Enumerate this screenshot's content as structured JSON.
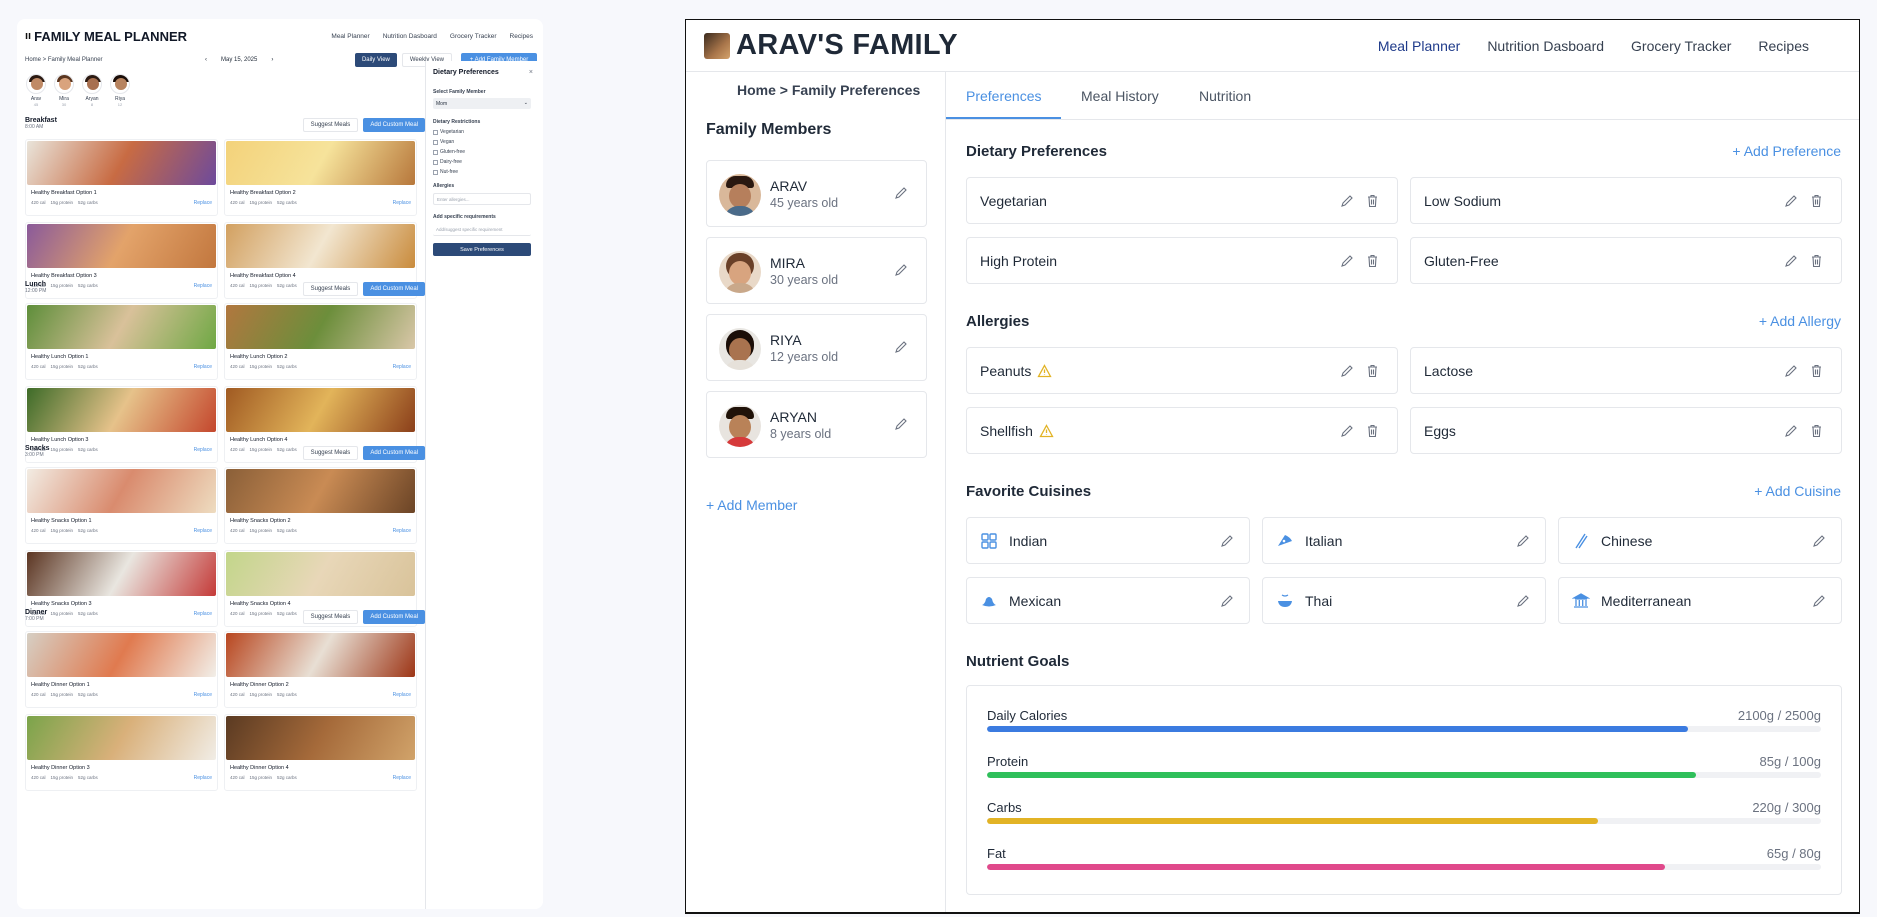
{
  "left": {
    "title": "FAMILY MEAL PLANNER",
    "title_icon": "fork-knife-icon",
    "nav": [
      "Meal Planner",
      "Nutrition Dasboard",
      "Grocery Tracker",
      "Recipes"
    ],
    "breadcrumb": "Home > Family Meal Planner",
    "date": "May 15, 2025",
    "prev": "‹",
    "next": "›",
    "daily_view": "Daily View",
    "weekly_view": "Weekly View",
    "add_family_member": "+ Add Family Member",
    "members": [
      {
        "name": "Arav",
        "age": "45"
      },
      {
        "name": "Mira",
        "age": "30"
      },
      {
        "name": "Aryan",
        "age": "8"
      },
      {
        "name": "Riya",
        "age": "12"
      }
    ],
    "suggest_meals": "Suggest Meals",
    "add_custom_meal": "Add Custom Meal",
    "replace": "Replace",
    "meals": [
      {
        "name": "Breakfast",
        "time": "8:00 AM",
        "options": [
          {
            "title": "Healthy Breakfast Option 1",
            "cal": "420 cal",
            "protein": "15g protein",
            "carbs": "52g carbs"
          },
          {
            "title": "Healthy Breakfast Option 2",
            "cal": "420 cal",
            "protein": "15g protein",
            "carbs": "52g carbs"
          },
          {
            "title": "Healthy Breakfast Option 3",
            "cal": "420 cal",
            "protein": "15g protein",
            "carbs": "52g carbs"
          },
          {
            "title": "Healthy Breakfast Option 4",
            "cal": "420 cal",
            "protein": "15g protein",
            "carbs": "52g carbs"
          }
        ]
      },
      {
        "name": "Lunch",
        "time": "12:00 PM",
        "options": [
          {
            "title": "Healthy Lunch Option 1",
            "cal": "420 cal",
            "protein": "15g protein",
            "carbs": "52g carbs"
          },
          {
            "title": "Healthy Lunch Option 2",
            "cal": "420 cal",
            "protein": "15g protein",
            "carbs": "52g carbs"
          },
          {
            "title": "Healthy Lunch Option 3",
            "cal": "420 cal",
            "protein": "15g protein",
            "carbs": "52g carbs"
          },
          {
            "title": "Healthy Lunch Option 4",
            "cal": "420 cal",
            "protein": "15g protein",
            "carbs": "52g carbs"
          }
        ]
      },
      {
        "name": "Snacks",
        "time": "3:00 PM",
        "options": [
          {
            "title": "Healthy Snacks Option 1",
            "cal": "420 cal",
            "protein": "15g protein",
            "carbs": "52g carbs"
          },
          {
            "title": "Healthy Snacks Option 2",
            "cal": "420 cal",
            "protein": "15g protein",
            "carbs": "52g carbs"
          },
          {
            "title": "Healthy Snacks Option 3",
            "cal": "420 cal",
            "protein": "15g protein",
            "carbs": "52g carbs"
          },
          {
            "title": "Healthy Snacks Option 4",
            "cal": "420 cal",
            "protein": "15g protein",
            "carbs": "52g carbs"
          }
        ]
      },
      {
        "name": "Dinner",
        "time": "7:00 PM",
        "options": [
          {
            "title": "Healthy Dinner Option 1",
            "cal": "420 cal",
            "protein": "15g protein",
            "carbs": "52g carbs"
          },
          {
            "title": "Healthy Dinner Option 2",
            "cal": "420 cal",
            "protein": "15g protein",
            "carbs": "52g carbs"
          },
          {
            "title": "Healthy Dinner Option 3",
            "cal": "420 cal",
            "protein": "15g protein",
            "carbs": "52g carbs"
          },
          {
            "title": "Healthy Dinner Option 4",
            "cal": "420 cal",
            "protein": "15g protein",
            "carbs": "52g carbs"
          }
        ]
      }
    ],
    "dietary_panel": {
      "title": "Dietary Preferences",
      "close": "×",
      "select_label": "Select Family Member",
      "select_value": "Mom",
      "restrictions_label": "Dietary Restrictions",
      "restrictions": [
        "Vegetarian",
        "Vegan",
        "Gluten-free",
        "Dairy-free",
        "Nut-free"
      ],
      "allergies_label": "Allergies",
      "allergies_placeholder": "Enter allergies...",
      "requirements_label": "Add specific requirements",
      "requirements_placeholder": "Add/suggest specific requirement",
      "save": "Save Preferences"
    }
  },
  "right": {
    "title": "ARAV'S FAMILY",
    "nav": [
      "Meal Planner",
      "Nutrition Dasboard",
      "Grocery Tracker",
      "Recipes"
    ],
    "active_nav": "Meal Planner",
    "breadcrumb": "Home > Family Preferences",
    "family_members_title": "Family Members",
    "members": [
      {
        "name": "ARAV",
        "age": "45 years old"
      },
      {
        "name": "MIRA",
        "age": "30 years old"
      },
      {
        "name": "RIYA",
        "age": "12 years old"
      },
      {
        "name": "ARYAN",
        "age": "8 years old"
      }
    ],
    "add_member": "+ Add Member",
    "tabs": [
      "Preferences",
      "Meal History",
      "Nutrition"
    ],
    "active_tab": "Preferences",
    "dietary": {
      "title": "Dietary Preferences",
      "add": "+ Add Preference",
      "items": [
        "Vegetarian",
        "Low Sodium",
        "High Protein",
        "Gluten-Free"
      ]
    },
    "allergies": {
      "title": "Allergies",
      "add": "+ Add Allergy",
      "items": [
        {
          "name": "Peanuts",
          "warning": true
        },
        {
          "name": "Lactose",
          "warning": false
        },
        {
          "name": "Shellfish",
          "warning": true
        },
        {
          "name": "Eggs",
          "warning": false
        }
      ]
    },
    "cuisines": {
      "title": "Favorite Cuisines",
      "add": "+ Add Cuisine",
      "items": [
        {
          "name": "Indian",
          "icon": "grid-icon"
        },
        {
          "name": "Italian",
          "icon": "pizza-icon"
        },
        {
          "name": "Chinese",
          "icon": "chopsticks-icon"
        },
        {
          "name": "Mexican",
          "icon": "hat-icon"
        },
        {
          "name": "Thai",
          "icon": "bowl-icon"
        },
        {
          "name": "Mediterranean",
          "icon": "columns-icon"
        }
      ]
    },
    "nutrient_goals": {
      "title": "Nutrient Goals",
      "items": [
        {
          "label": "Daily Calories",
          "value": "2100g / 2500g",
          "fraction": 0.84,
          "color": "#3b7be0"
        },
        {
          "label": "Protein",
          "value": "85g / 100g",
          "fraction": 0.85,
          "color": "#2fbf5a"
        },
        {
          "label": "Carbs",
          "value": "220g / 300g",
          "fraction": 0.733,
          "color": "#e2b325"
        },
        {
          "label": "Fat",
          "value": "65g / 80g",
          "fraction": 0.8125,
          "color": "#e0498b"
        }
      ]
    }
  }
}
